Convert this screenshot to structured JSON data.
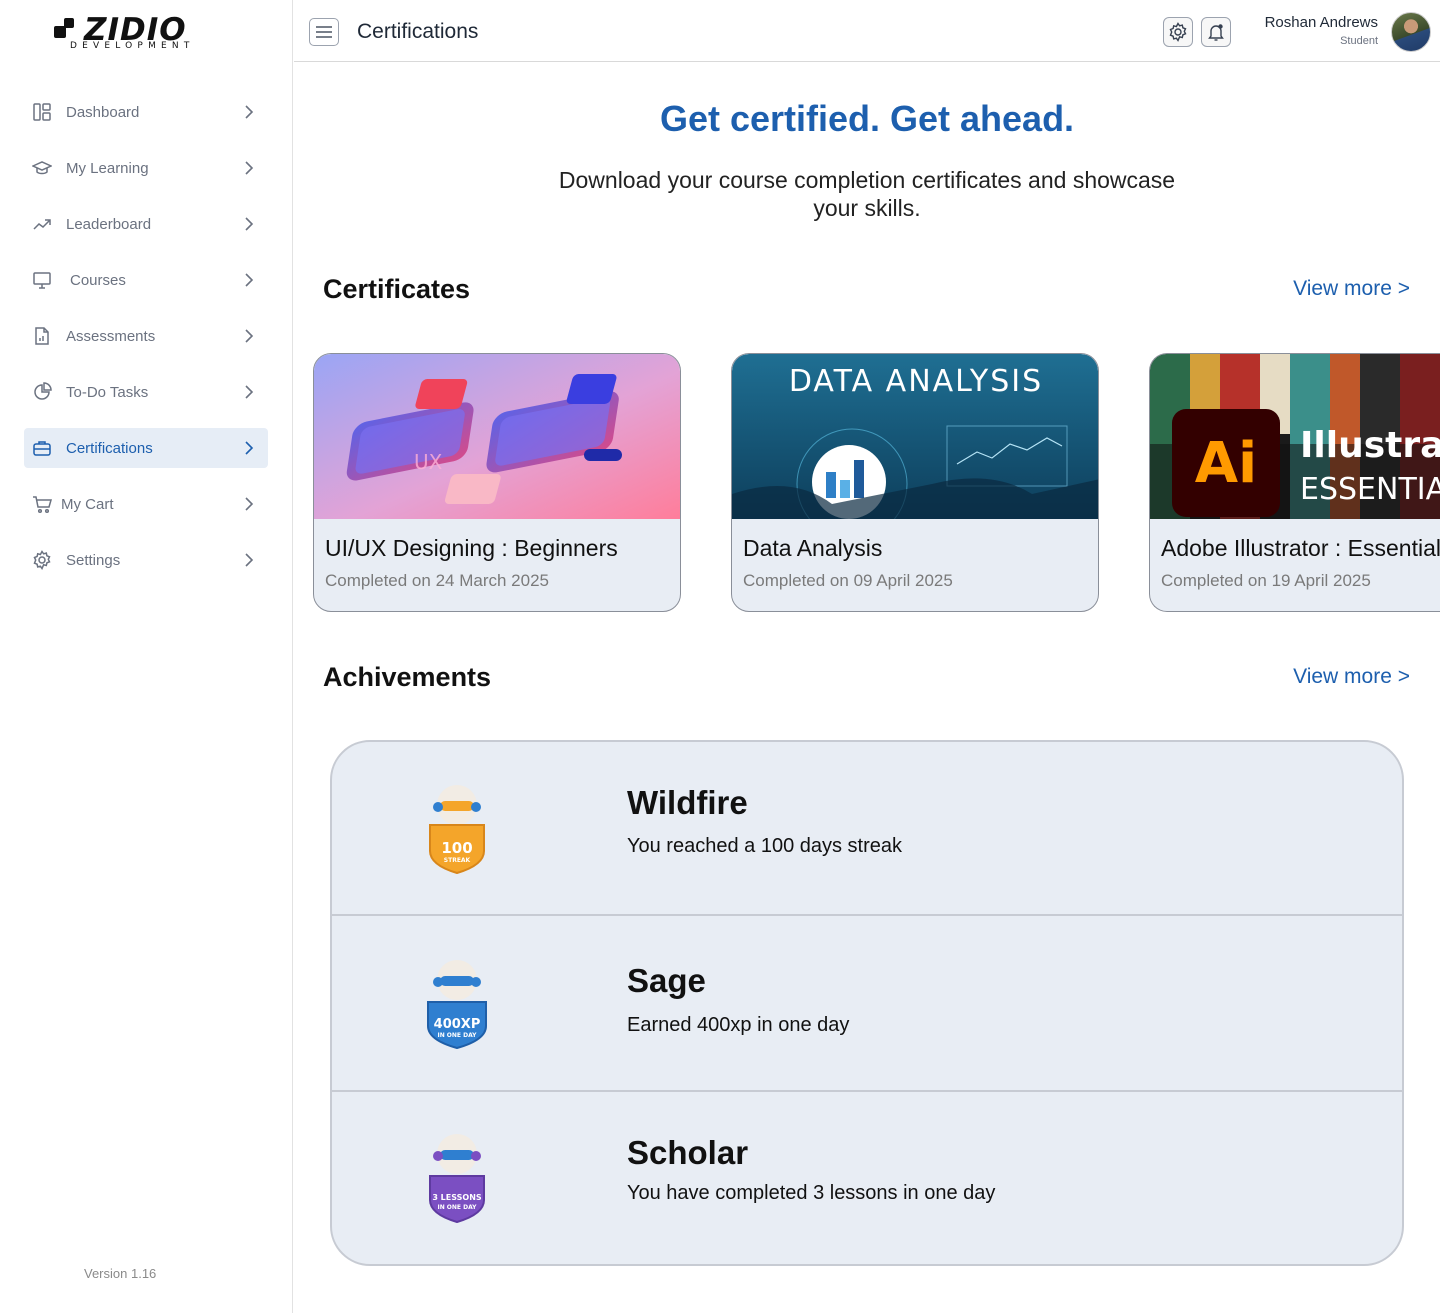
{
  "brand": {
    "name": "ZIDIO",
    "sub": "DEVELOPMENT"
  },
  "sidebar": {
    "items": [
      {
        "label": "Dashboard",
        "icon": "dashboard-icon",
        "active": false
      },
      {
        "label": "My Learning",
        "icon": "graduation-cap-icon",
        "active": false
      },
      {
        "label": "Leaderboard",
        "icon": "trending-up-icon",
        "active": false
      },
      {
        "label": "Courses",
        "icon": "monitor-icon",
        "active": false
      },
      {
        "label": "Assessments",
        "icon": "document-chart-icon",
        "active": false
      },
      {
        "label": "To-Do Tasks",
        "icon": "pie-clock-icon",
        "active": false
      },
      {
        "label": "Certifications",
        "icon": "briefcase-icon",
        "active": true
      },
      {
        "label": "My Cart",
        "icon": "cart-icon",
        "active": false
      },
      {
        "label": "Settings",
        "icon": "gear-icon",
        "active": false
      }
    ],
    "version": "Version 1.16"
  },
  "header": {
    "title": "Certifications",
    "user_name": "Roshan Andrews",
    "user_role": "Student"
  },
  "hero": {
    "title": "Get certified. Get ahead.",
    "subtitle": "Download your course completion certificates and showcase your skills."
  },
  "certificates": {
    "title": "Certificates",
    "view_more": "View more >",
    "items": [
      {
        "name": "UI/UX Designing : Beginners",
        "date": "Completed on 24 March 2025",
        "banner": ""
      },
      {
        "name": "Data Analysis",
        "date": "Completed on 09 April 2025",
        "banner": "DATA ANALYSIS"
      },
      {
        "name": "Adobe Illustrator : Essentials",
        "date": "Completed on 19 April 2025",
        "banner": "Illustrator",
        "banner_sub": "ESSENTIALS",
        "logo": "Ai"
      }
    ]
  },
  "achievements": {
    "title": "Achivements",
    "view_more": "View more >",
    "items": [
      {
        "title": "Wildfire",
        "desc": "You reached a 100 days streak",
        "badge_main": "100",
        "badge_sub": "STREAK",
        "color": "#f4a52a"
      },
      {
        "title": "Sage",
        "desc": "Earned 400xp in one day",
        "badge_main": "400XP",
        "badge_sub": "IN ONE DAY",
        "color": "#2f7fd0"
      },
      {
        "title": "Scholar",
        "desc": "You have completed 3 lessons in one day",
        "badge_main": "3 LESSONS",
        "badge_sub": "IN ONE DAY",
        "color": "#7b4fc2"
      }
    ]
  },
  "colors": {
    "accent": "#1d5fae",
    "active_bg": "#e6edf6",
    "card_bg": "#e8edf4"
  }
}
